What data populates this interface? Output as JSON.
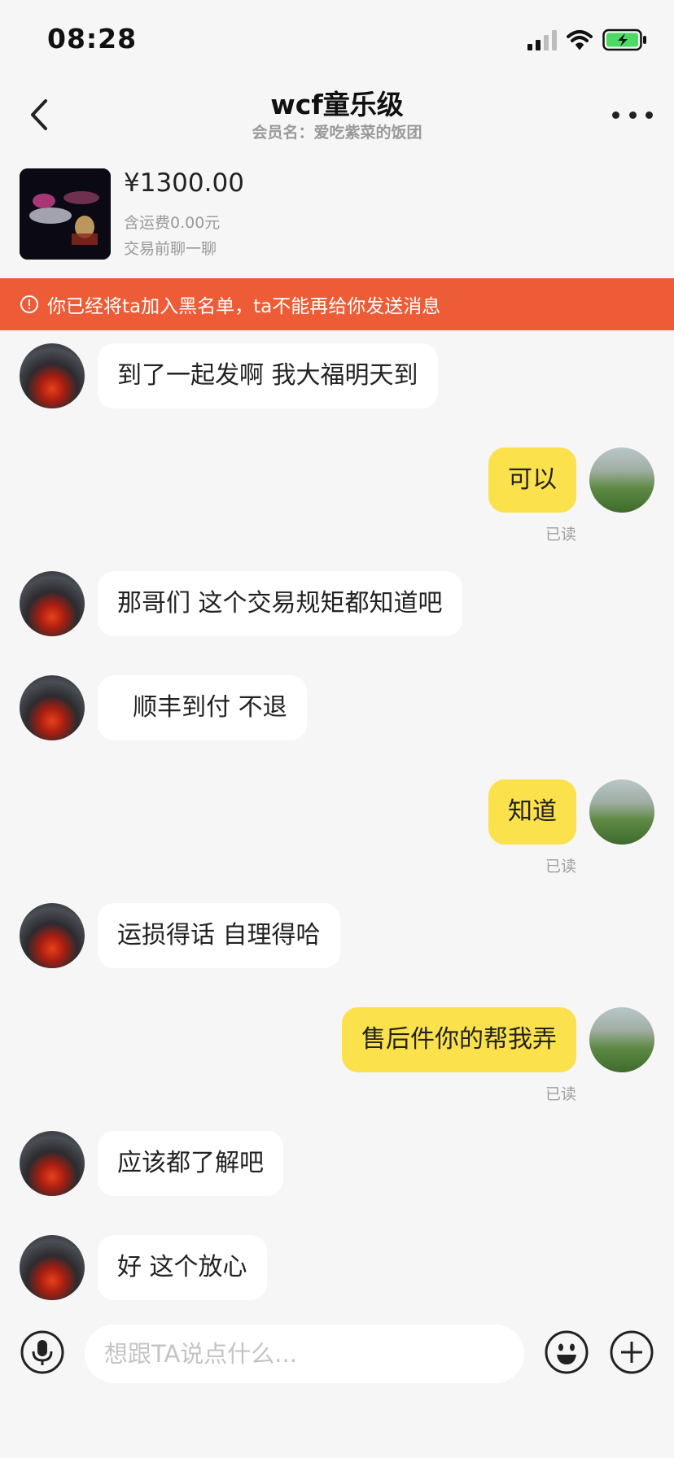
{
  "status_bar": {
    "time": "08:28",
    "signal_icon": "signal-bars-icon",
    "wifi_icon": "wifi-icon",
    "battery_icon": "battery-charging-icon",
    "battery_color": "#4cd964"
  },
  "header": {
    "title": "wcf童乐级",
    "subtitle": "会员名：爱吃紫菜的饭团",
    "back_icon": "chevron-left-icon",
    "more_icon": "more-dots-icon"
  },
  "product": {
    "price": "¥1300.00",
    "shipping": "含运费0.00元",
    "note": "交易前聊一聊"
  },
  "banner": {
    "text": "你已经将ta加入黑名单，ta不能再给你发送消息",
    "icon": "alert-circle-icon",
    "color": "#ed5c36"
  },
  "messages": [
    {
      "from": "other",
      "text": "到了一起发啊 我大福明天到"
    },
    {
      "from": "me",
      "text": "可以",
      "status": "已读"
    },
    {
      "from": "other",
      "text": "那哥们 这个交易规矩都知道吧"
    },
    {
      "from": "other",
      "text": "  顺丰到付 不退"
    },
    {
      "from": "me",
      "text": "知道",
      "status": "已读"
    },
    {
      "from": "other",
      "text": "运损得话 自理得哈"
    },
    {
      "from": "me",
      "text": "售后件你的帮我弄",
      "status": "已读"
    },
    {
      "from": "other",
      "text": "应该都了解吧"
    },
    {
      "from": "other",
      "text": "好 这个放心"
    }
  ],
  "input": {
    "placeholder": "想跟TA说点什么...",
    "value": "",
    "mic_icon": "microphone-icon",
    "emoji_icon": "emoji-icon",
    "plus_icon": "plus-circle-icon"
  },
  "colors": {
    "my_bubble": "#fbe14b",
    "other_bubble": "#ffffff",
    "background": "#f6f6f6"
  }
}
